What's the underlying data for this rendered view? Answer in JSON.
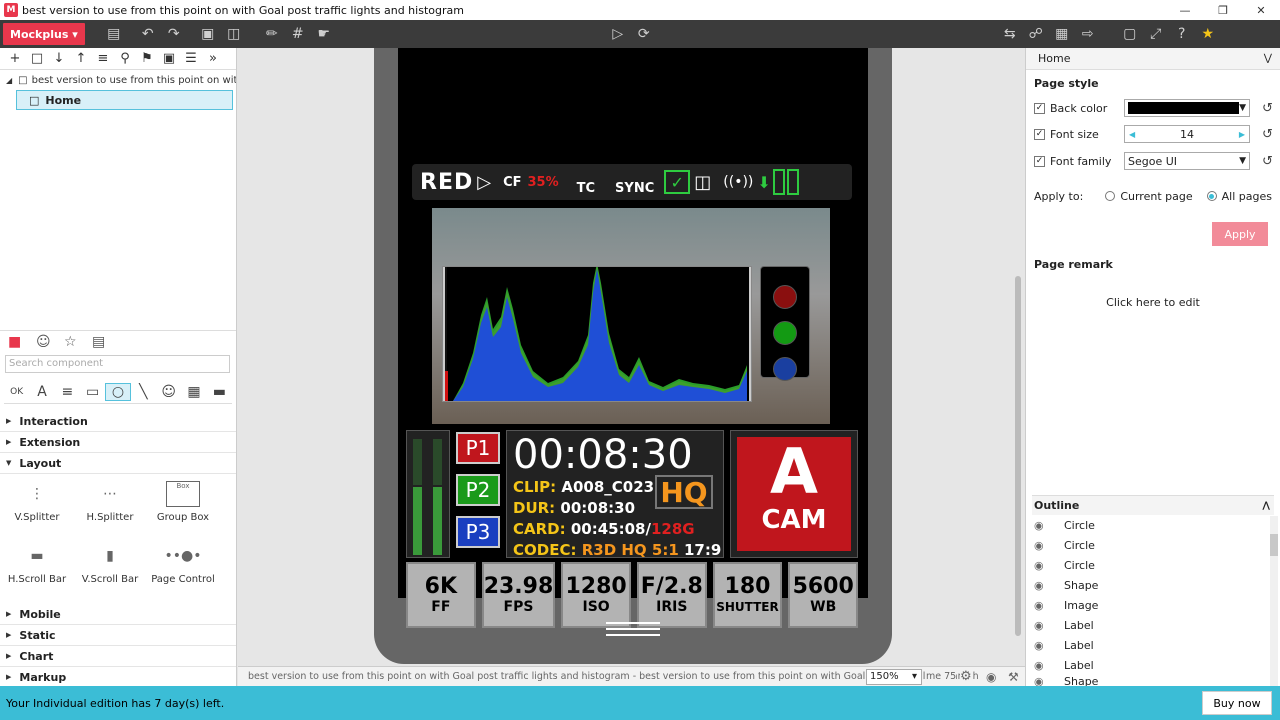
{
  "window": {
    "title": "best version to use from this point on with Goal post traffic lights and histogram"
  },
  "toolbar": {
    "app_button": "Mockplus"
  },
  "left": {
    "tree_root": "best version to use from this point on with Gc",
    "tree_home": "Home",
    "search_placeholder": "Search component",
    "categories": [
      "Interaction",
      "Extension",
      "Layout",
      "Mobile",
      "Static",
      "Chart",
      "Markup"
    ],
    "layout_items": [
      "V.Splitter",
      "H.Splitter",
      "Group Box",
      "H.Scroll Bar",
      "V.Scroll Bar",
      "Page Control"
    ],
    "groupbox_caption": "Box"
  },
  "camera": {
    "logo": "RED",
    "cf_label": "CF",
    "cf_value": "35%",
    "tc_label": "TC",
    "sync_label": "SYNC",
    "presets": [
      "P1",
      "P2",
      "P3"
    ],
    "timecode": "00:08:30",
    "clip_label": "CLIP:",
    "clip_value": "A008_C023",
    "dur_label": "DUR:",
    "dur_value": "00:08:30",
    "card_label": "CARD:",
    "card_value": "00:45:08/",
    "card_size": "128G",
    "codec_label": "CODEC:",
    "codec_value": "R3D HQ 5:1",
    "aspect": "17:9",
    "hq": "HQ",
    "cam_letter": "A",
    "cam_word": "CAM",
    "tiles": [
      {
        "value": "6K",
        "label": "FF"
      },
      {
        "value": "23.98",
        "label": "FPS"
      },
      {
        "value": "1280",
        "label": "ISO"
      },
      {
        "value": "F/2.8",
        "label": "IRIS"
      },
      {
        "value": "180",
        "label": "SHUTTER"
      },
      {
        "value": "5600",
        "label": "WB"
      }
    ]
  },
  "status": {
    "text": "best version to use from this point on with Goal post traffic lights and histogram - best version to use from this point on with Goal post traffic lights and h",
    "zoom": "150%",
    "tail": "me 75"
  },
  "right": {
    "header": "Home",
    "page_style": "Page style",
    "back_color_label": "Back color",
    "font_size_label": "Font size",
    "font_size_value": "14",
    "font_family_label": "Font family",
    "font_family_value": "Segoe UI",
    "apply_to_label": "Apply to:",
    "current_page": "Current page",
    "all_pages": "All pages",
    "apply_button": "Apply",
    "page_remark": "Page remark",
    "click_to_edit": "Click here to edit",
    "outline_title": "Outline",
    "outline_items": [
      "Circle",
      "Circle",
      "Circle",
      "Shape",
      "Image",
      "Label",
      "Label",
      "Label",
      "Shape"
    ]
  },
  "bottom": {
    "trial": "Your Individual edition has 7 day(s) left.",
    "buy": "Buy now"
  },
  "colors": {
    "brand": "#e8374c",
    "accent": "#3bbdd6",
    "cam_red": "#c0161d",
    "preset_green": "#1a9a1a",
    "preset_blue": "#1a3fc0"
  }
}
